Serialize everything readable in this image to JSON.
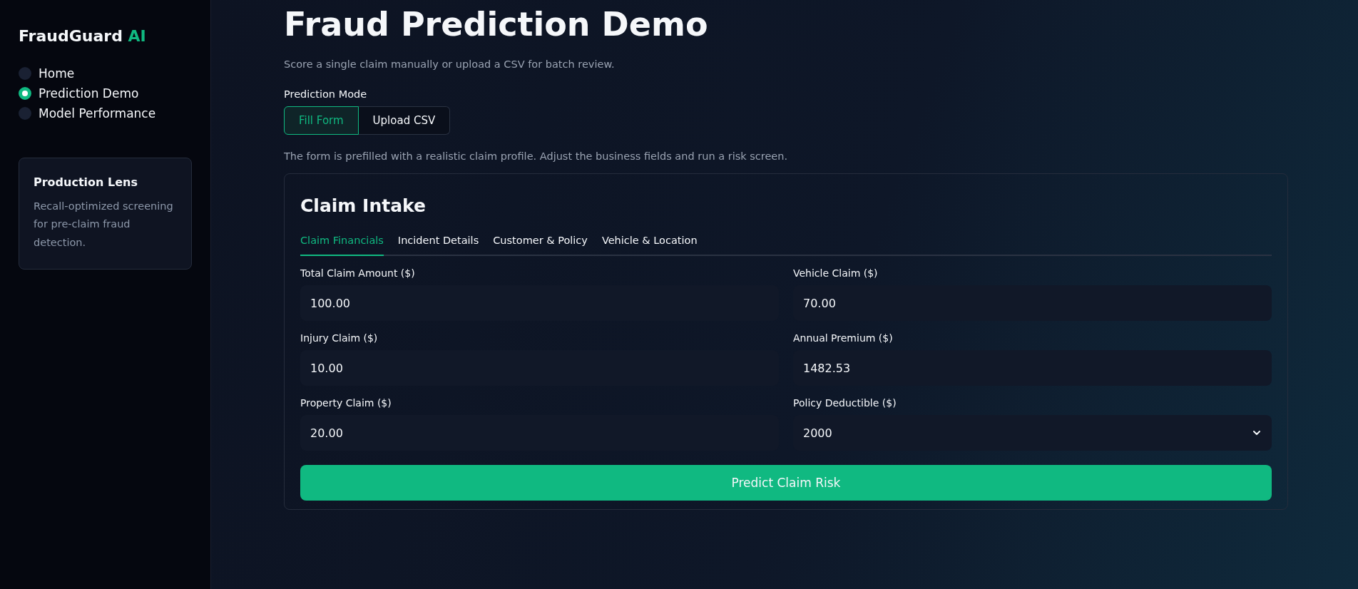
{
  "sidebar": {
    "brand": {
      "name": "FraudGuard",
      "accent": "AI"
    },
    "nav": [
      {
        "label": "Home",
        "selected": false
      },
      {
        "label": "Prediction Demo",
        "selected": true
      },
      {
        "label": "Model Performance",
        "selected": false
      }
    ],
    "info_card": {
      "title": "Production Lens",
      "text": "Recall-optimized screening for pre-claim fraud detection."
    }
  },
  "main": {
    "title": "Fraud Prediction Demo",
    "subtitle": "Score a single claim manually or upload a CSV for batch review.",
    "mode": {
      "label": "Prediction Mode",
      "options": [
        {
          "label": "Fill Form",
          "selected": true
        },
        {
          "label": "Upload CSV",
          "selected": false
        }
      ]
    },
    "note": "The form is prefilled with a realistic claim profile. Adjust the business fields and run a risk screen.",
    "card": {
      "title": "Claim Intake",
      "tabs": [
        {
          "label": "Claim Financials",
          "selected": true
        },
        {
          "label": "Incident Details",
          "selected": false
        },
        {
          "label": "Customer & Policy",
          "selected": false
        },
        {
          "label": "Vehicle & Location",
          "selected": false
        }
      ],
      "fields": [
        {
          "label": "Total Claim Amount ($)",
          "value": "100.00",
          "kind": "number"
        },
        {
          "label": "Vehicle Claim ($)",
          "value": "70.00",
          "kind": "number"
        },
        {
          "label": "Injury Claim ($)",
          "value": "10.00",
          "kind": "number"
        },
        {
          "label": "Annual Premium ($)",
          "value": "1482.53",
          "kind": "number"
        },
        {
          "label": "Property Claim ($)",
          "value": "20.00",
          "kind": "number"
        },
        {
          "label": "Policy Deductible ($)",
          "value": "2000",
          "kind": "select"
        }
      ],
      "button": "Predict Claim Risk"
    }
  }
}
